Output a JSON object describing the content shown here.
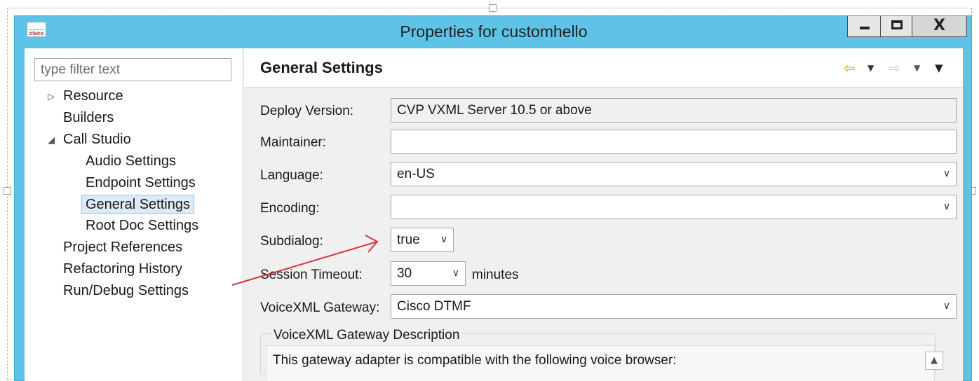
{
  "window": {
    "title": "Properties for customhello",
    "app_icon_text": "cisco",
    "controls": {
      "minimize_icon": "minimize-icon",
      "maximize_icon": "maximize-icon",
      "close_glyph": "X"
    }
  },
  "filter": {
    "placeholder": "type filter text",
    "value": ""
  },
  "tree": {
    "items": [
      {
        "label": "Resource",
        "expander": "▷"
      },
      {
        "label": "Builders"
      },
      {
        "label": "Call Studio",
        "expander": "◢"
      },
      {
        "label": "Audio Settings"
      },
      {
        "label": "Endpoint Settings"
      },
      {
        "label": "General Settings",
        "selected": true
      },
      {
        "label": "Root Doc Settings"
      },
      {
        "label": "Project References"
      },
      {
        "label": "Refactoring History"
      },
      {
        "label": "Run/Debug Settings"
      }
    ]
  },
  "page": {
    "title": "General Settings",
    "nav": {
      "back_icon": "back-arrow-icon",
      "forward_icon": "forward-arrow-icon",
      "menu_icon": "view-menu-icon"
    }
  },
  "form": {
    "deploy_version": {
      "label": "Deploy Version:",
      "value": "CVP VXML Server 10.5 or above"
    },
    "maintainer": {
      "label": "Maintainer:",
      "value": ""
    },
    "language": {
      "label": "Language:",
      "value": "en-US"
    },
    "encoding": {
      "label": "Encoding:",
      "value": ""
    },
    "subdialog": {
      "label": "Subdialog:",
      "value": "true"
    },
    "session_timeout": {
      "label": "Session Timeout:",
      "value": "30",
      "units": "minutes"
    },
    "voicexml_gateway": {
      "label": "VoiceXML Gateway:",
      "value": "Cisco DTMF"
    }
  },
  "gateway_description": {
    "legend": "VoiceXML Gateway Description",
    "text": "This gateway adapter is compatible with the following voice browser:"
  },
  "colors": {
    "titlebar": "#5fc3e8",
    "annotation_arrow": "#d9343a",
    "selection": "#dceaf8"
  }
}
